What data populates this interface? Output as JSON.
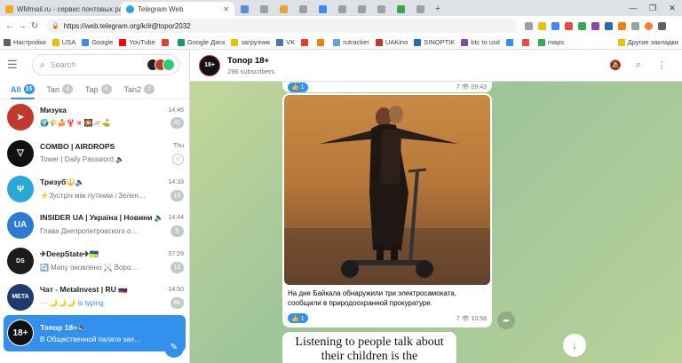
{
  "browser": {
    "tabs": [
      {
        "label": "WMmail.ru - сервис почтовых ра",
        "icon": "wmmail-icon",
        "color": "#f5a623",
        "active": false
      },
      {
        "label": "Telegram Web",
        "icon": "telegram-icon",
        "color": "#2aa3e0",
        "active": true
      }
    ],
    "url": "https://web.telegram.org/k/#@topor2032",
    "bookmarks": [
      {
        "label": "Настройки",
        "color": "#5f6368"
      },
      {
        "label": "USA",
        "color": "#f0c000"
      },
      {
        "label": "Google",
        "color": "#4285f4"
      },
      {
        "label": "YouTube",
        "color": "#ff0000"
      },
      {
        "label": "",
        "color": "#d44638"
      },
      {
        "label": "Google Диск",
        "color": "#0f9d58"
      },
      {
        "label": "загрузчик",
        "color": "#f0c000"
      },
      {
        "label": "VK",
        "color": "#4a76a8"
      },
      {
        "label": "",
        "color": "#e04020"
      },
      {
        "label": "",
        "color": "#ee8208"
      },
      {
        "label": "rutracker",
        "color": "#6a9fd4"
      },
      {
        "label": "UAKino",
        "color": "#c0392b"
      },
      {
        "label": "SINOPTIK",
        "color": "#2a6ab0"
      },
      {
        "label": "btc to usd",
        "color": "#8e44ad"
      },
      {
        "label": "",
        "color": "#3390ec"
      },
      {
        "label": "",
        "color": "#e74c3c"
      },
      {
        "label": "maps",
        "color": "#34a853"
      }
    ],
    "other_bookmarks": "Другие закладки"
  },
  "sidebar": {
    "search_placeholder": "Search",
    "folders": [
      {
        "label": "All",
        "count": "15",
        "active": true
      },
      {
        "label": "Tan",
        "count": "4",
        "active": false
      },
      {
        "label": "Tap",
        "count": "4",
        "active": false
      },
      {
        "label": "Tan2",
        "count": "2",
        "active": false
      }
    ],
    "chats": [
      {
        "name": "Мизука",
        "name_icon": "🔈",
        "time": "14:46",
        "preview": "🌍🌾🍰🦞🍬🎇🪐⛳",
        "badge": "42",
        "avatar_color": "#c0392b",
        "avatar_icon": "paper-plane-icon"
      },
      {
        "name": "COMBO | AIRDROPS",
        "name_icon": "",
        "time": "Thu",
        "preview": "Tower | Daily Password 🔈",
        "badge": "",
        "pinned": true,
        "avatar_color": "#111111",
        "avatar_icon": "ton-icon"
      },
      {
        "name": "Тризуб🔱🔈",
        "name_icon": "",
        "time": "14:33",
        "preview": "⚡Зустріч між путіним і Зелен…",
        "badge": "16",
        "avatar_color": "#29a8d8",
        "avatar_icon": "trident-icon"
      },
      {
        "name": "INSIDER UA | Україна | Новини 🔈",
        "name_icon": "",
        "time": "14:44",
        "preview": "Глава Днепропетровского о…",
        "badge": "5",
        "avatar_color": "#2c7ad1",
        "avatar_icon": "ukraine-map-icon"
      },
      {
        "name": "✈DeepState✈🇺🇦",
        "name_icon": "",
        "time": "07:29",
        "preview": "🔄 Мапу оновлено ⚔️ Воро…",
        "badge": "12",
        "avatar_color": "#1c1c1c",
        "avatar_icon": "deepstate-icon"
      },
      {
        "name": "Чат - MetaInvest | RU 🇷🇺",
        "name_icon": "",
        "time": "14:50",
        "preview": "··· 🌙🌙🌙 is typing",
        "badge": "8K",
        "typing": true,
        "avatar_color": "#1e3a6e",
        "avatar_icon": "meta-icon"
      },
      {
        "name": "Топор 18+🔈",
        "name_icon": "",
        "time": "",
        "preview": "В Общественной палате зая…",
        "badge": "",
        "selected": true,
        "avatar_color": "#111111",
        "avatar_icon": "topor-icon"
      }
    ]
  },
  "channel": {
    "name": "Топор 18+",
    "subscribers": "296 subscribers",
    "prev_post": {
      "reaction": "👍 1",
      "views": "7",
      "time": "09:43"
    },
    "post": {
      "caption": "На дне Байкала обнаружили три электросамоката, сообщили в природоохранной прокуратуре.",
      "reaction": "👍 1",
      "views": "7",
      "time": "10:58"
    },
    "next_post_text": "Listening to people talk about their children is the"
  }
}
